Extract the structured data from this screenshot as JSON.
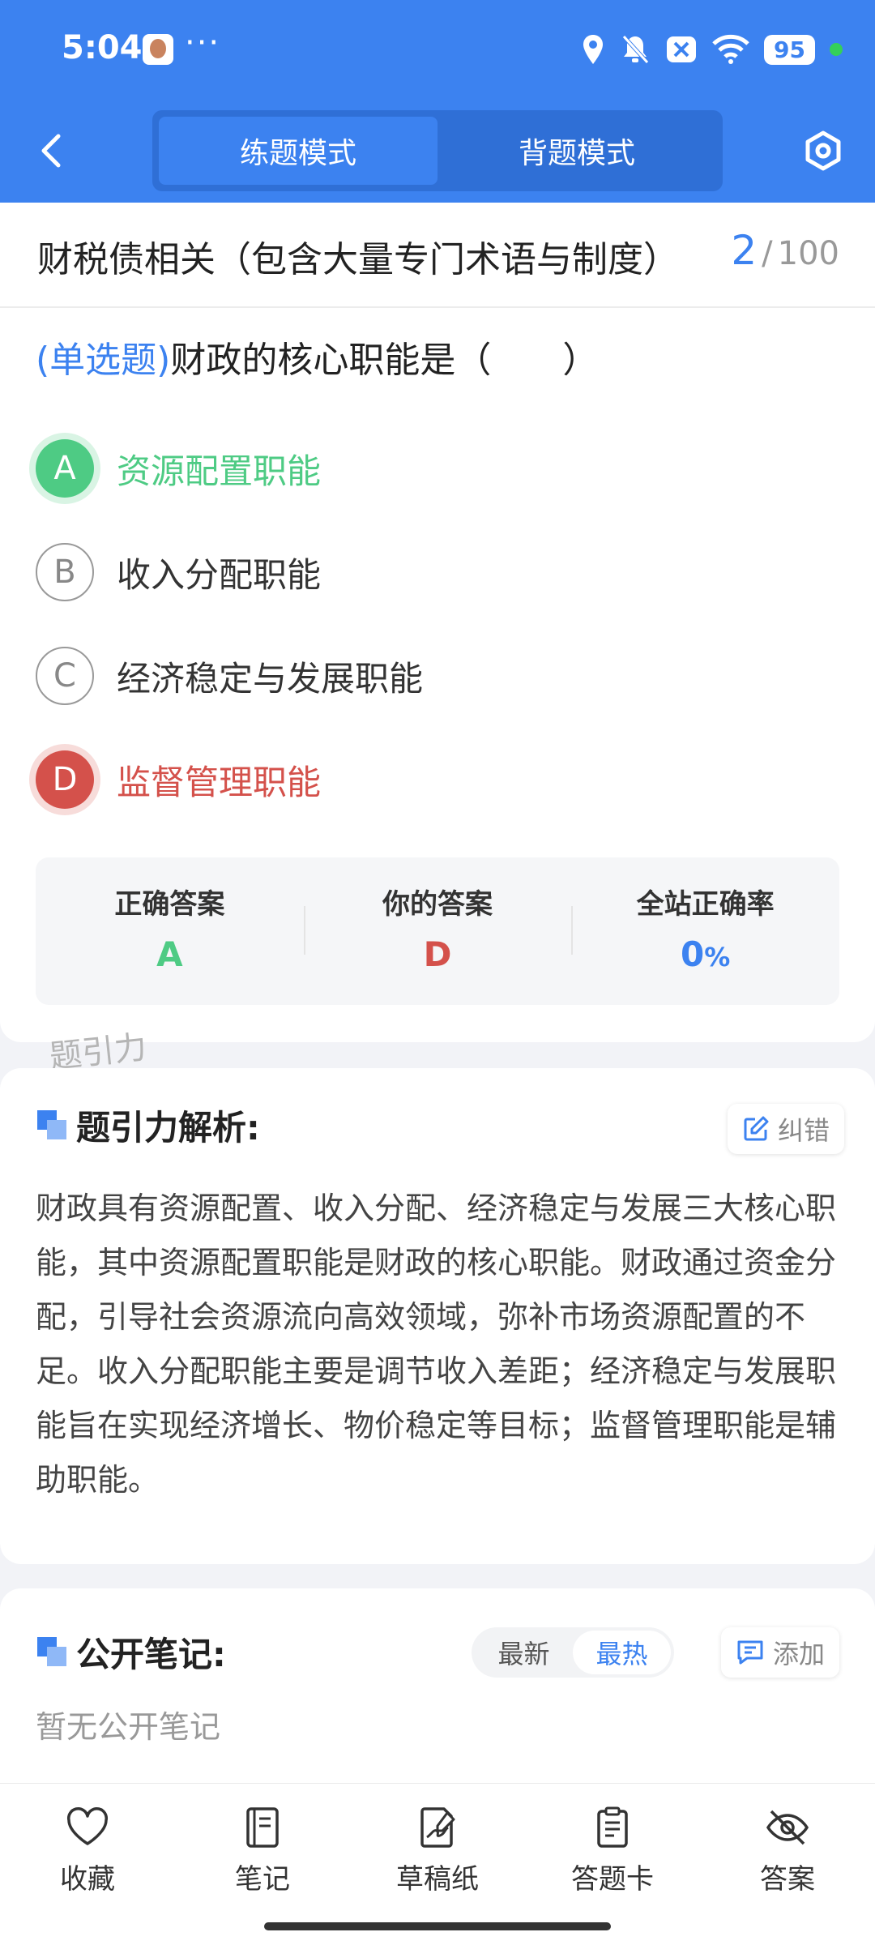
{
  "status_bar": {
    "time": "5:04",
    "dots": "···",
    "battery": "95"
  },
  "header": {
    "modes": [
      {
        "label": "练题模式",
        "active": true
      },
      {
        "label": "背题模式",
        "active": false
      }
    ]
  },
  "question": {
    "title": "财税债相关（包含大量专门术语与制度）",
    "progress_current": "2",
    "progress_separator": "/",
    "progress_total": "100",
    "type_label": "(单选题)",
    "text": "财政的核心职能是（　　）",
    "options": [
      {
        "letter": "A",
        "text": "资源配置职能",
        "state": "correct"
      },
      {
        "letter": "B",
        "text": "收入分配职能",
        "state": "normal"
      },
      {
        "letter": "C",
        "text": "经济稳定与发展职能",
        "state": "normal"
      },
      {
        "letter": "D",
        "text": "监督管理职能",
        "state": "wrong"
      }
    ]
  },
  "answer_summary": {
    "correct_label": "正确答案",
    "correct_value": "A",
    "yours_label": "你的答案",
    "yours_value": "D",
    "rate_label": "全站正确率",
    "rate_value": "0",
    "rate_unit": "%"
  },
  "watermark": "题引力",
  "explanation": {
    "title": "题引力解析:",
    "report_label": "纠错",
    "text": "财政具有资源配置、收入分配、经济稳定与发展三大核心职能，其中资源配置职能是财政的核心职能。财政通过资金分配，引导社会资源流向高效领域，弥补市场资源配置的不足。收入分配职能主要是调节收入差距；经济稳定与发展职能旨在实现经济增长、物价稳定等目标；监督管理职能是辅助职能。"
  },
  "notes": {
    "title": "公开笔记:",
    "sort_latest": "最新",
    "sort_hot": "最热",
    "add_label": "添加",
    "empty_text": "暂无公开笔记"
  },
  "bottom_nav": {
    "favorite": "收藏",
    "notes": "笔记",
    "scratch": "草稿纸",
    "answer_card": "答题卡",
    "answer": "答案"
  },
  "colors": {
    "primary": "#3c82f0",
    "correct": "#4ecb84",
    "wrong": "#d4514b"
  }
}
